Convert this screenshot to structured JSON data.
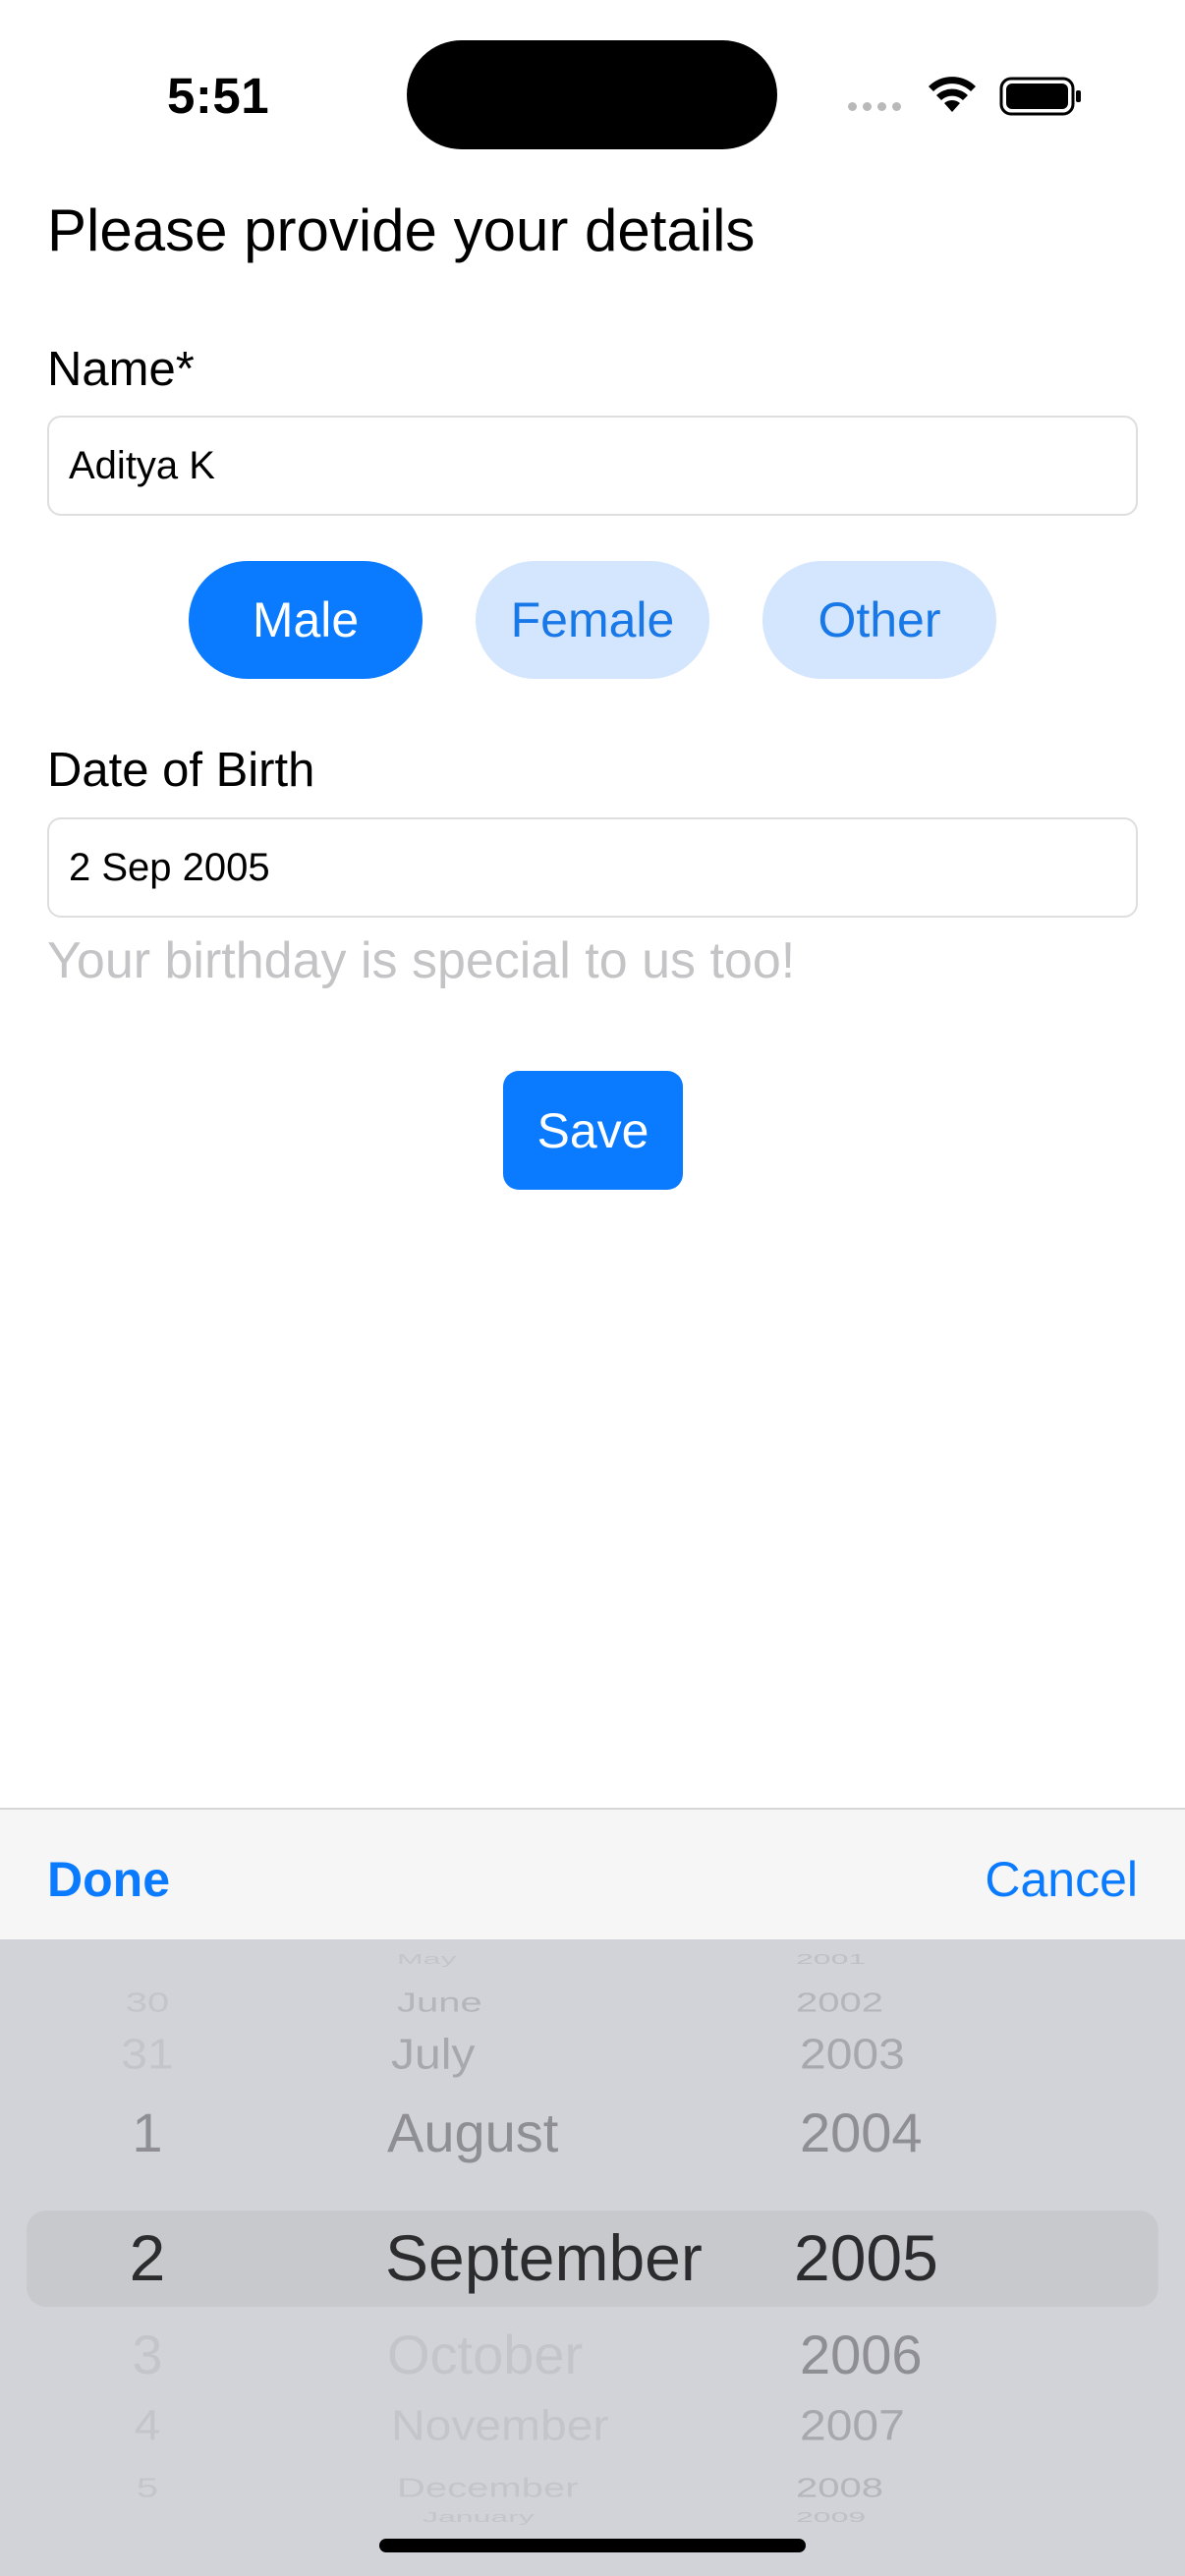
{
  "status_bar": {
    "time": "5:51"
  },
  "page": {
    "title": "Please provide your details",
    "name_label": "Name*",
    "name_value": "Aditya K",
    "gender_options": [
      "Male",
      "Female",
      "Other"
    ],
    "gender_selected": "Male",
    "dob_label": "Date of Birth",
    "dob_value": "2 Sep 2005",
    "dob_hint": "Your birthday is special to us too!",
    "save_label": "Save"
  },
  "picker_toolbar": {
    "done_label": "Done",
    "cancel_label": "Cancel"
  },
  "date_picker": {
    "days": [
      "30",
      "31",
      "1",
      "2",
      "3",
      "4",
      "5"
    ],
    "months": [
      "May",
      "June",
      "July",
      "August",
      "September",
      "October",
      "November",
      "December",
      "January"
    ],
    "years": [
      "2001",
      "2002",
      "2003",
      "2004",
      "2005",
      "2006",
      "2007",
      "2008",
      "2009"
    ],
    "selected_day": "2",
    "selected_month": "September",
    "selected_year": "2005"
  },
  "colors": {
    "accent": "#0a7aff",
    "accent_light": "#d4e6fd",
    "picker_bg": "#d1d3d9"
  }
}
